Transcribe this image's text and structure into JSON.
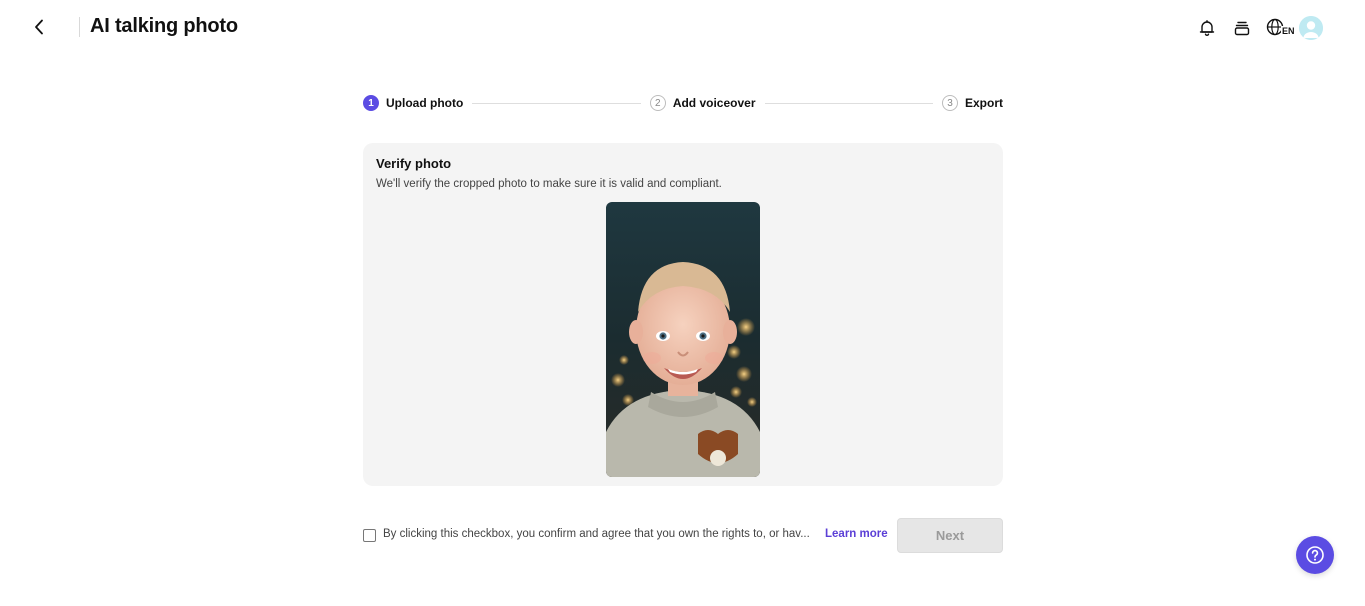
{
  "header": {
    "title": "AI talking photo",
    "back_icon": "chevron-left-icon",
    "icons": [
      "bell-icon",
      "stack-icon",
      "globe-language-icon"
    ],
    "language_code": "EN"
  },
  "stepper": {
    "steps": [
      {
        "number": "1",
        "label": "Upload photo",
        "active": true
      },
      {
        "number": "2",
        "label": "Add voiceover",
        "active": false
      },
      {
        "number": "3",
        "label": "Export",
        "active": false
      }
    ],
    "active_color": "#5b4ce3"
  },
  "verify": {
    "title": "Verify photo",
    "subtitle": "We'll verify the cropped photo to make sure it is valid and compliant."
  },
  "consent": {
    "text": "By clicking this checkbox, you confirm and agree that you own the rights to, or hav...",
    "learn_more": "Learn more",
    "checked": false
  },
  "actions": {
    "next_label": "Next",
    "next_enabled": false
  },
  "colors": {
    "accent": "#5b4ce3",
    "link": "#5b3fd6",
    "card_bg": "#f4f4f4"
  }
}
